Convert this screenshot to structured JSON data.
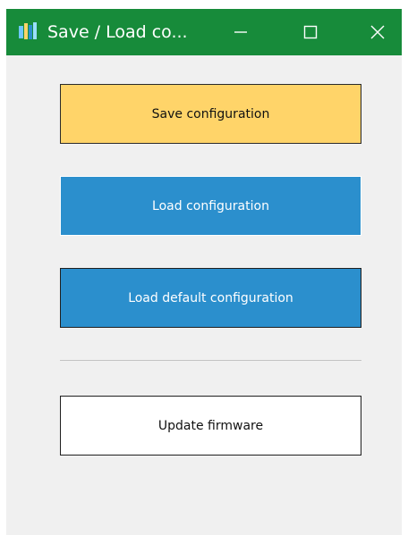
{
  "window": {
    "title": "Save / Load co...",
    "titlebar_color": "#178b3a",
    "background_color": "#f0f0f0",
    "app_icon": "app-logo-icon",
    "controls": {
      "minimize_icon": "minimize-icon",
      "maximize_icon": "maximize-icon",
      "close_icon": "close-icon"
    }
  },
  "buttons": {
    "save_label": "Save configuration",
    "save_color": "#ffd469",
    "load_label": "Load configuration",
    "load_color": "#2b8fcd",
    "load_default_label": "Load default configuration",
    "load_default_color": "#2b8fcd",
    "update_firmware_label": "Update firmware",
    "update_firmware_color": "#ffffff"
  }
}
